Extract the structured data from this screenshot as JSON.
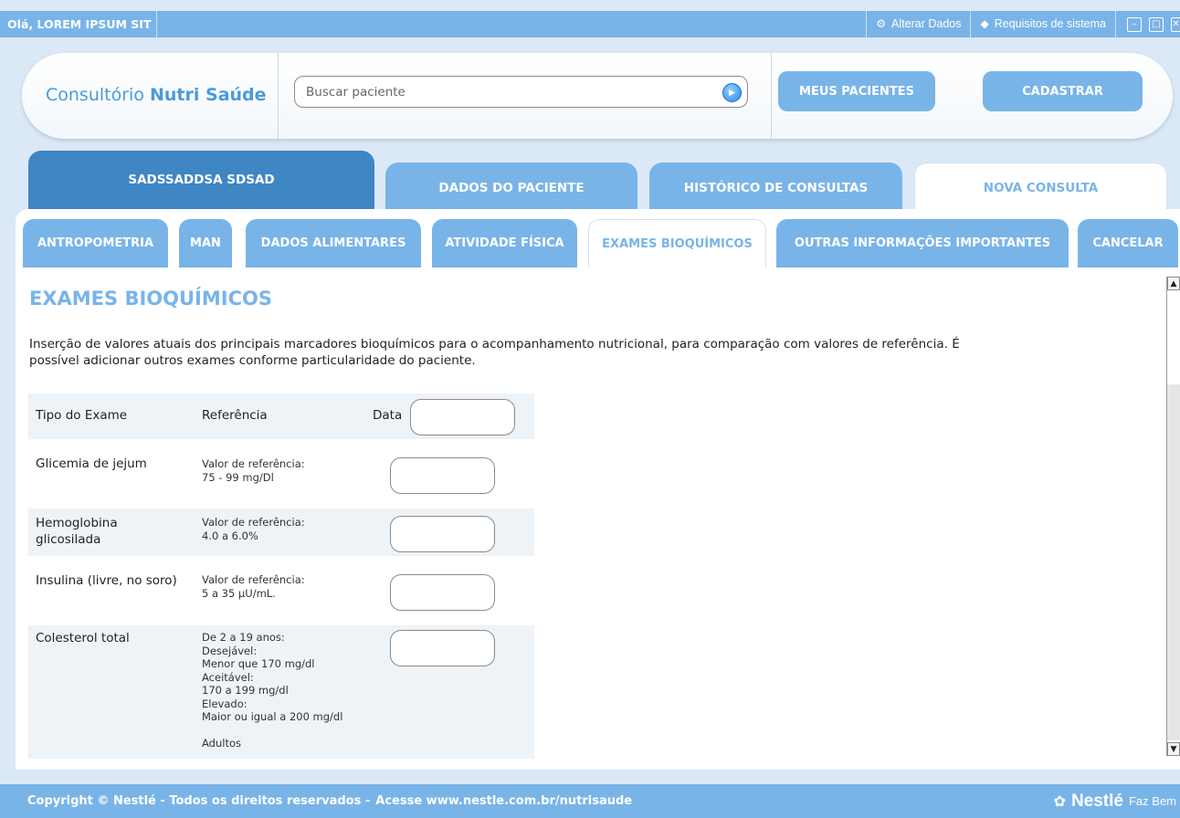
{
  "topbar": {
    "greeting": "Olá, LOREM IPSUM SIT",
    "alterar_dados": "Alterar Dados",
    "requisitos": "Requisitos de sistema"
  },
  "header": {
    "brand_light": "Consultório",
    "brand_bold": "Nutri Saúde",
    "search_placeholder": "Buscar paciente",
    "meus_pacientes": "MEUS PACIENTES",
    "cadastrar": "CADASTRAR"
  },
  "main_tabs": {
    "patient": "SADSSADDSA SDSAD",
    "dados": "DADOS DO PACIENTE",
    "historico": "HISTÓRICO DE CONSULTAS",
    "nova": "NOVA CONSULTA"
  },
  "sub_tabs": [
    "ANTROPOMETRIA",
    "MAN",
    "DADOS ALIMENTARES",
    "ATIVIDADE FÍSICA",
    "EXAMES BIOQUÍMICOS",
    "OUTRAS INFORMAÇÕES IMPORTANTES",
    "CANCELAR"
  ],
  "active_sub_tab": "EXAMES BIOQUÍMICOS",
  "page": {
    "title": "EXAMES BIOQUÍMICOS",
    "intro": "Inserção de valores atuais dos principais marcadores bioquímicos para o acompanhamento nutricional, para comparação com valores de referência. É possível adicionar outros exames conforme particularidade do paciente."
  },
  "table": {
    "headers": {
      "tipo": "Tipo do Exame",
      "referencia": "Referência",
      "data": "Data"
    },
    "rows": [
      {
        "tipo": "Glicemia de jejum",
        "ref": "Valor de referência:\n75 - 99 mg/Dl"
      },
      {
        "tipo": "Hemoglobina\nglicosilada",
        "ref": "Valor de referência:\n4.0 a 6.0%"
      },
      {
        "tipo": "Insulina (livre, no soro)",
        "ref": "Valor de referência:\n5 a 35 μU/mL."
      },
      {
        "tipo": "Colesterol total",
        "ref": "De 2 a 19 anos:\nDesejável:\nMenor que 170 mg/dl\nAceitável:\n170 a 199 mg/dl\nElevado:\nMaior ou igual a 200 mg/dl\n\nAdultos"
      }
    ]
  },
  "footer": {
    "copyright": "Copyright © Nestlé - Todos os direitos reservados -",
    "url": "Acesse www.nestle.com.br/nutrisaude",
    "brand": "Nestlé",
    "tagline": "Faz Bem"
  }
}
